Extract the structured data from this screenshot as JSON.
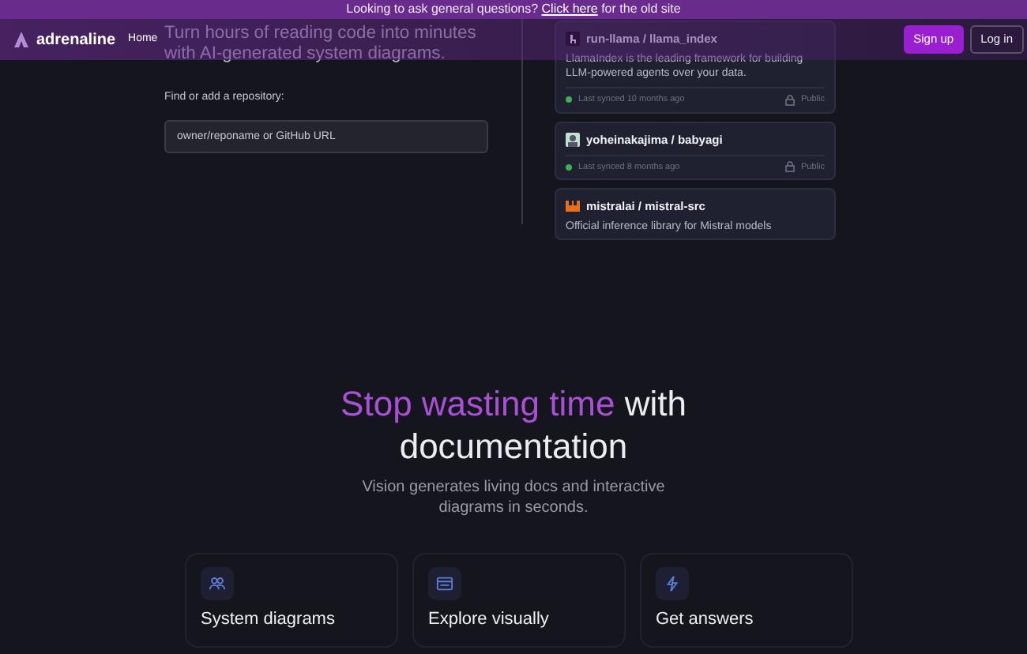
{
  "banner": {
    "text": "Looking to ask general questions?",
    "link": "Click here",
    "suffix": "for the old site"
  },
  "navbar": {
    "logo": "adrenaline",
    "links": [
      {
        "label": "Home",
        "selected": true
      }
    ],
    "signup": "Sign up",
    "login": "Log in"
  },
  "hero": {
    "subtitle": "Turn hours of reading code into minutes with AI-generated system diagrams.",
    "repo_label": "Find or add a repository:",
    "repo_placeholder": "owner/reponame or GitHub URL"
  },
  "repositories": [
    {
      "name": "run-llama / llama_index",
      "description": "LlamaIndex is the leading framework for building LLM-powered agents over your data.",
      "status": "Last synced 10 months ago",
      "visibility": "Public"
    },
    {
      "name": "yoheinakajima / babyagi",
      "status": "Last synced 8 months ago",
      "visibility": "Public"
    },
    {
      "name": "mistralai / mistral-src",
      "description": "Official inference library for Mistral models"
    }
  ],
  "section": {
    "heading_highlight": "Stop wasting time",
    "heading_rest": "with documentation",
    "subtitle": "Vision generates living docs and interactive diagrams in seconds."
  },
  "features": [
    {
      "title": "System diagrams"
    },
    {
      "title": "Explore visually"
    },
    {
      "title": "Get answers"
    }
  ]
}
